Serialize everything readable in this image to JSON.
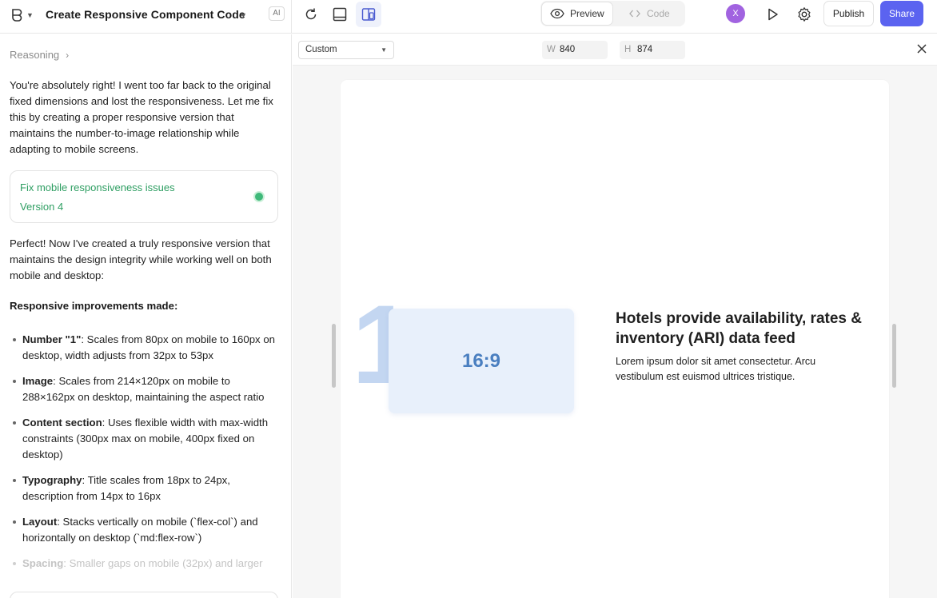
{
  "header": {
    "title": "Create Responsive Component Code",
    "ai_badge": "AI",
    "preview_label": "Preview",
    "code_label": "Code",
    "avatar_initial": "X",
    "publish_label": "Publish",
    "share_label": "Share"
  },
  "chat": {
    "reasoning_label": "Reasoning",
    "intro": "You're absolutely right! I went too far back to the original fixed dimensions and lost the responsiveness. Let me fix this by creating a proper responsive version that maintains the number-to-image relationship while adapting to mobile screens.",
    "version_card": {
      "title": "Fix mobile responsiveness issues",
      "version": "Version 4"
    },
    "followup": "Perfect! Now I've created a truly responsive version that maintains the design integrity while working well on both mobile and desktop:",
    "heading": "Responsive improvements made:",
    "items": [
      {
        "term": "Number \"1\"",
        "text": ": Scales from 80px on mobile to 160px on desktop, width adjusts from 32px to 53px"
      },
      {
        "term": "Image",
        "text": ": Scales from 214×120px on mobile to 288×162px on desktop, maintaining the aspect ratio"
      },
      {
        "term": "Content section",
        "text": ": Uses flexible width with max-width constraints (300px max on mobile, 400px fixed on desktop)"
      },
      {
        "term": "Typography",
        "text": ": Title scales from 18px to 24px, description from 14px to 16px"
      },
      {
        "term": "Layout",
        "text": ": Stacks vertically on mobile (`flex-col`) and horizontally on desktop (`md:flex-row`)"
      },
      {
        "term": "Spacing",
        "text": ": Smaller gaps on mobile (32px) and larger"
      }
    ]
  },
  "viewport": {
    "preset": "Custom",
    "width_label": "W",
    "width_value": "840",
    "height_label": "H",
    "height_value": "874"
  },
  "preview": {
    "number": "1",
    "image_label": "16:9",
    "title": "Hotels provide availability, rates & inventory (ARI) data feed",
    "description": "Lorem ipsum dolor sit amet consectetur. Arcu vestibulum est euismod ultrices tristique."
  },
  "colors": {
    "share_button": "#5b63f0",
    "version_green": "#2e9e62",
    "avatar": "#a163e0",
    "image_card": "#e8f0fb",
    "big_number": "#c3d6f1"
  }
}
